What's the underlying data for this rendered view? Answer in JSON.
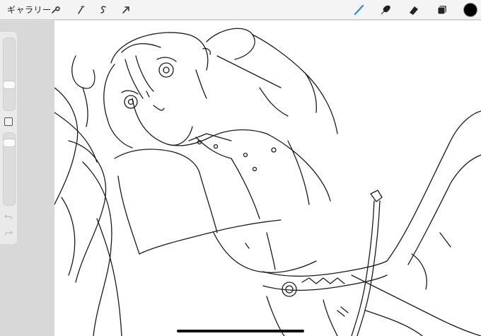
{
  "toolbar": {
    "gallery_label": "ギャラリー",
    "left_tools": [
      "wrench-icon",
      "magic-wand-icon",
      "selection-icon",
      "transform-arrow-icon"
    ],
    "right_tools": [
      "brush-icon",
      "smudge-icon",
      "eraser-icon",
      "layers-icon",
      "color-swatch-icon"
    ],
    "active_tool": "brush",
    "active_color": "#3a8ee6",
    "current_color": "#000000"
  },
  "sidebar": {
    "size_slider_icon": "brush-size-slider",
    "opacity_slider_icon": "opacity-slider",
    "modify_icon": "square-modify-icon",
    "undo_icon": "undo-icon",
    "redo_icon": "redo-icon"
  },
  "canvas": {
    "background": "#ffffff",
    "stroke_color": "#1a1a1a"
  }
}
